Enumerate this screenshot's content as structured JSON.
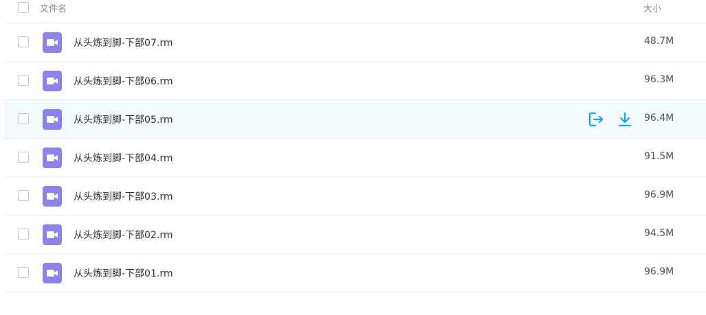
{
  "header": {
    "name_label": "文件名",
    "size_label": "大小"
  },
  "colors": {
    "accent": "#06a7ff",
    "file_icon": "#8c82ee",
    "hover_row": "#f5fafd"
  },
  "files": [
    {
      "name": "从头炼到脚-下部07.rm",
      "size": "48.7M",
      "icon": "video-icon"
    },
    {
      "name": "从头炼到脚-下部06.rm",
      "size": "96.3M",
      "icon": "video-icon"
    },
    {
      "name": "从头炼到脚-下部05.rm",
      "size": "96.4M",
      "icon": "video-icon",
      "hovered": true,
      "actions": [
        "share-icon",
        "download-icon"
      ]
    },
    {
      "name": "从头炼到脚-下部04.rm",
      "size": "91.5M",
      "icon": "video-icon"
    },
    {
      "name": "从头炼到脚-下部03.rm",
      "size": "96.9M",
      "icon": "video-icon"
    },
    {
      "name": "从头炼到脚-下部02.rm",
      "size": "94.5M",
      "icon": "video-icon"
    },
    {
      "name": "从头炼到脚-下部01.rm",
      "size": "96.9M",
      "icon": "video-icon"
    }
  ]
}
